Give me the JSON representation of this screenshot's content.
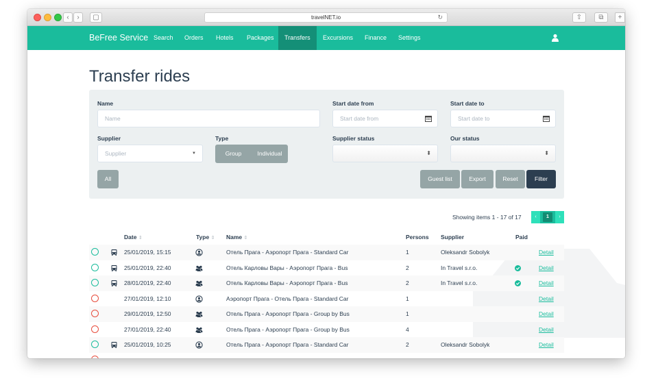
{
  "browser": {
    "url": "travelNET.io"
  },
  "nav": {
    "brand": "BeFree Service",
    "items": [
      "Search",
      "Orders",
      "Hotels",
      "Packages",
      "Transfers",
      "Excursions",
      "Finance",
      "Settings"
    ],
    "active": "Transfers",
    "user_icon": "user-icon"
  },
  "page": {
    "title": "Transfer rides"
  },
  "filters": {
    "name_label": "Name",
    "name_placeholder": "Name",
    "start_from_label": "Start date from",
    "start_from_placeholder": "Start date from",
    "start_to_label": "Start date to",
    "start_to_placeholder": "Start date to",
    "supplier_label": "Supplier",
    "supplier_placeholder": "Supplier",
    "type_label": "Type",
    "type_group": "Group",
    "type_individual": "Individual",
    "supplier_status_label": "Supplier status",
    "our_status_label": "Our status",
    "all_button": "All",
    "guest_list_button": "Guest list",
    "export_button": "Export",
    "reset_button": "Reset",
    "filter_button": "Filter"
  },
  "pagination": {
    "summary": "Showing items 1 - 17 of 17",
    "prev": "‹",
    "current": "1",
    "next": "›"
  },
  "table": {
    "headers": {
      "date": "Date",
      "type": "Type",
      "name": "Name",
      "persons": "Persons",
      "supplier": "Supplier",
      "paid": "Paid"
    },
    "rows": [
      {
        "status": "green",
        "vehicle": true,
        "date": "25/01/2019, 15:15",
        "type": "individual",
        "name": "Отель Прага - Аэропорт Прага - Standard Car",
        "persons": "1",
        "supplier": "Oleksandr Sobolyk",
        "paid": false,
        "detail": "Detail"
      },
      {
        "status": "green",
        "vehicle": true,
        "date": "25/01/2019, 22:40",
        "type": "group",
        "name": "Отель Карловы Вары - Аэропорт Прага - Bus",
        "persons": "2",
        "supplier": "In Travel s.r.o.",
        "paid": true,
        "detail": "Detail"
      },
      {
        "status": "green",
        "vehicle": true,
        "date": "28/01/2019, 22:40",
        "type": "group",
        "name": "Отель Карловы Вары - Аэропорт Прага - Bus",
        "persons": "2",
        "supplier": "In Travel s.r.o.",
        "paid": true,
        "detail": "Detail"
      },
      {
        "status": "red",
        "vehicle": false,
        "date": "27/01/2019, 12:10",
        "type": "individual",
        "name": "Аэропорт Прага - Отель Прага - Standard Car",
        "persons": "1",
        "supplier": "",
        "paid": false,
        "detail": "Detail"
      },
      {
        "status": "red",
        "vehicle": false,
        "date": "29/01/2019, 12:50",
        "type": "group",
        "name": "Отель Прага - Аэропорт Прага - Group by Bus",
        "persons": "1",
        "supplier": "",
        "paid": false,
        "detail": "Detail"
      },
      {
        "status": "red",
        "vehicle": false,
        "date": "27/01/2019, 22:40",
        "type": "group",
        "name": "Отель Прага - Аэропорт Прага - Group by Bus",
        "persons": "4",
        "supplier": "",
        "paid": false,
        "detail": "Detail"
      },
      {
        "status": "green",
        "vehicle": true,
        "date": "25/01/2019, 10:25",
        "type": "individual",
        "name": "Отель Прага - Аэропорт Прага - Standard Car",
        "persons": "2",
        "supplier": "Oleksandr Sobolyk",
        "paid": false,
        "detail": "Detail"
      }
    ]
  },
  "colors": {
    "accent": "#1abc9c",
    "dark": "#2c3e50",
    "grey": "#95a5a6",
    "red": "#e74c3c"
  }
}
